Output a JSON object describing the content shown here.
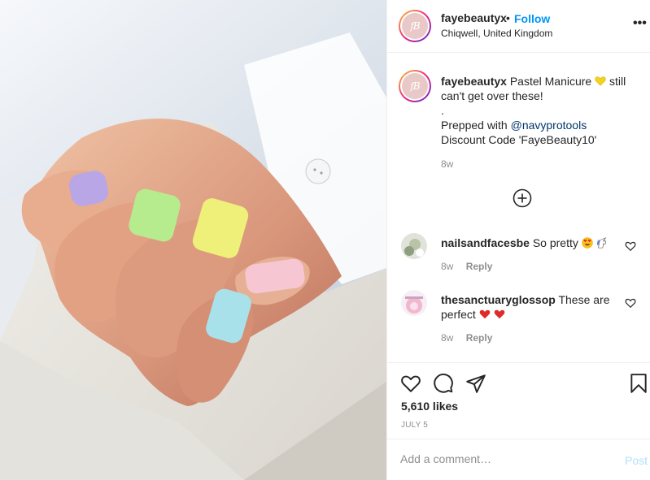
{
  "post": {
    "image_alt": "Hand with pastel manicure nails resting on white shirt sleeve"
  },
  "header": {
    "avatar_initials": "fB",
    "username": "fayebeautyx",
    "separator": "•",
    "follow_label": "Follow",
    "location": "Chiqwell, United Kingdom",
    "more_icon": "more-horizontal-icon",
    "more_label": "•••"
  },
  "caption": {
    "avatar_initials": "fB",
    "username": "fayebeautyx",
    "text_part1": "Pastel Manicure",
    "emoji": "yellow-heart-icon",
    "text_part2": "still can't get over these!",
    "line_dot": ".",
    "prepped_text": "Prepped with",
    "mention": "@navyprotools",
    "discount": "Discount Code 'FayeBeauty10'",
    "time": "8w"
  },
  "load_more_icon": "plus-circle-icon",
  "comments": [
    {
      "username": "nailsandfacesbe",
      "text": "So pretty",
      "emojis": [
        "heart-eyes-icon",
        "unicorn-icon"
      ],
      "time": "8w",
      "reply_label": "Reply"
    },
    {
      "username": "thesanctuaryglossop",
      "text_part1": "These are",
      "text_part2": "perfect",
      "emojis": [
        "red-heart-icon",
        "red-heart-icon"
      ],
      "time": "8w",
      "reply_label": "Reply"
    }
  ],
  "actions": {
    "like_icon": "heart-icon",
    "comment_icon": "comment-icon",
    "share_icon": "paper-plane-icon",
    "save_icon": "bookmark-icon",
    "likes_text": "5,610 likes",
    "date": "JULY 5"
  },
  "comment_box": {
    "placeholder": "Add a comment…",
    "post_label": "Post"
  },
  "colors": {
    "link_blue": "#0095f6",
    "mention": "#00376b",
    "muted": "#8e8e8e",
    "post_disabled": "#b2dffc",
    "nail_lilac": "#b9a6e6",
    "nail_green": "#b7ec8e",
    "nail_yellow": "#eef07a",
    "nail_pink": "#f7c6d3",
    "nail_blue": "#a9e1ea"
  }
}
